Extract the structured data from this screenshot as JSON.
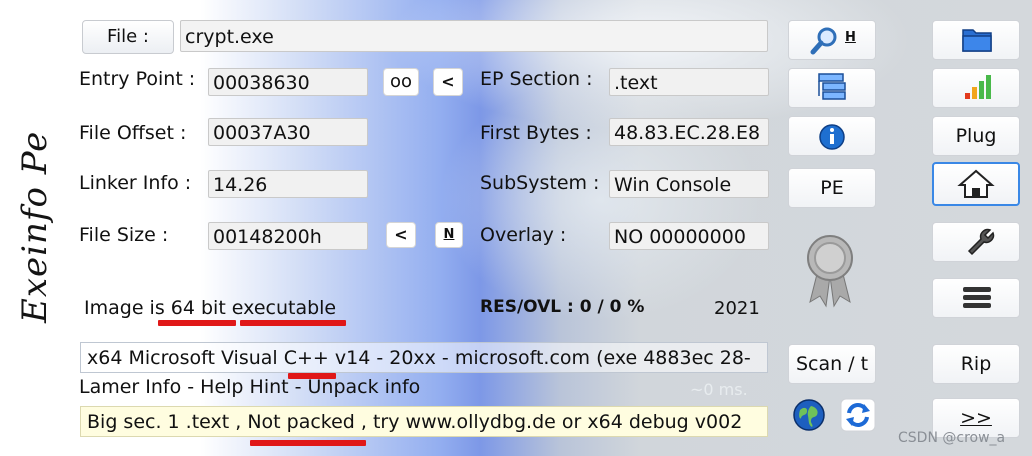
{
  "file": {
    "button_label": "File :",
    "value": "crypt.exe"
  },
  "entry_point": {
    "label": "Entry Point :",
    "value": "00038630",
    "btn_oo": "oo",
    "btn_lt": "<"
  },
  "ep_section": {
    "label": "EP Section :",
    "value": ".text"
  },
  "file_offset": {
    "label": "File Offset :",
    "value": "00037A30"
  },
  "first_bytes": {
    "label": "First Bytes :",
    "value": "48.83.EC.28.E8"
  },
  "linker_info": {
    "label": "Linker Info :",
    "value": "14.26"
  },
  "subsystem": {
    "label": "SubSystem :",
    "value": "Win Console"
  },
  "file_size": {
    "label": "File Size :",
    "value": "00148200h",
    "btn_lt": "<",
    "btn_n": "N"
  },
  "overlay": {
    "label": "Overlay :",
    "value": "NO   00000000"
  },
  "image_info": {
    "text": "Image is 64 bit executable",
    "res_ovl": "RES/OVL : 0 / 0 %",
    "year": "2021"
  },
  "detection": {
    "text": "x64 Microsoft Visual C++ v14 - 20xx - microsoft.com (exe 4883ec 28-"
  },
  "lamer_info": {
    "text": "Lamer Info - Help Hint - Unpack info",
    "time": "~0 ms."
  },
  "hint": {
    "text": "Big sec. 1 .text , Not packed , try  www.ollydbg.de or x64 debug v002"
  },
  "middle_buttons": {
    "h_label": "H",
    "pe_label": "PE",
    "scan_label": "Scan / t"
  },
  "right_buttons": {
    "plug_label": "Plug",
    "rip_label": "Rip",
    "next_label": ">>"
  },
  "logo_text": "Exeinfo Pe",
  "watermark": "CSDN @crow_a",
  "colors": {
    "underline_red": "#e01818",
    "accent_blue": "#3a88e6"
  }
}
